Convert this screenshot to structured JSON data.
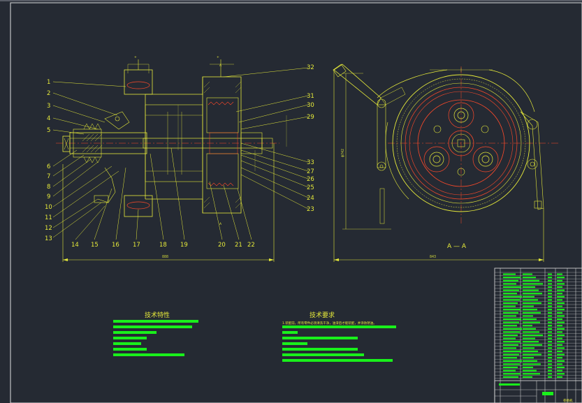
{
  "drawing": {
    "part_labels_left": [
      "1",
      "2",
      "3",
      "4",
      "5",
      "6",
      "7",
      "8",
      "9",
      "10",
      "11",
      "12",
      "13"
    ],
    "part_labels_bottom": [
      "14",
      "15",
      "16",
      "17",
      "18",
      "19",
      "20",
      "21",
      "22"
    ],
    "part_labels_right": [
      "32",
      "31",
      "30",
      "29",
      "33",
      "27",
      "26",
      "25",
      "24",
      "23"
    ],
    "section_mark": "A",
    "section_title": "A — A",
    "overall_width_left": "888",
    "overall_width_right": "843",
    "height_right": "ϕ742"
  },
  "notes": {
    "tech_spec_title": "技术特性",
    "tech_req_title": "技术要求",
    "tech_req_line1": "1.装配前，所有零件必须清洗干净，油漆后才能装配，并涂防锈油。"
  },
  "title_block": {
    "bottom_text": "卷扬机"
  },
  "colors": {
    "background": "#252a33",
    "outline": "#e6ea3a",
    "gear": "#ff4a2a",
    "text_block": "#19f01b",
    "frame": "#e0e0e0"
  }
}
